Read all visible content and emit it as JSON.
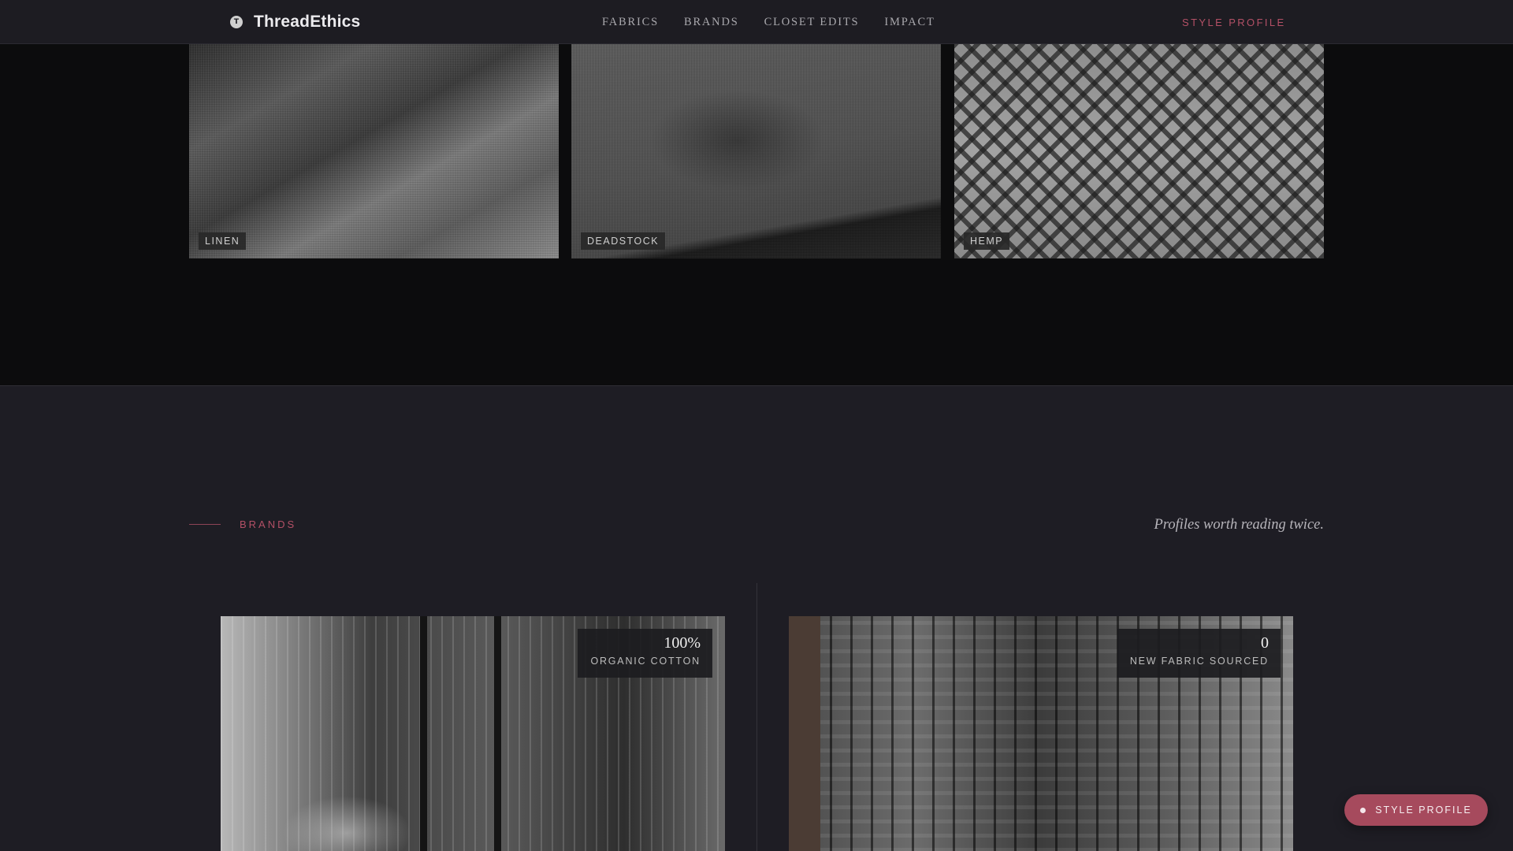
{
  "header": {
    "logo_icon": "thread-logo-icon",
    "brand_name": "ThreadEthics",
    "nav": [
      "FABRICS",
      "BRANDS",
      "CLOSET EDITS",
      "IMPACT"
    ],
    "cta_label": "STYLE PROFILE"
  },
  "fabrics": {
    "tiles": [
      {
        "label": "LINEN"
      },
      {
        "label": "DEADSTOCK"
      },
      {
        "label": "HEMP"
      }
    ]
  },
  "brands": {
    "section_label": "BRANDS",
    "tagline": "Profiles worth reading twice.",
    "cards": [
      {
        "stat_value": "100%",
        "stat_caption": "ORGANIC COTTON"
      },
      {
        "stat_value": "0",
        "stat_caption": "NEW FABRIC SOURCED"
      }
    ]
  },
  "floating_button": {
    "label": "STYLE PROFILE",
    "icon": "dot-icon"
  },
  "colors": {
    "accent": "#b35066",
    "button_bg": "#a64a5d",
    "nav_bg": "#1d1c22",
    "section_bg": "#1e1d24",
    "page_bg": "#0c0c0d"
  }
}
